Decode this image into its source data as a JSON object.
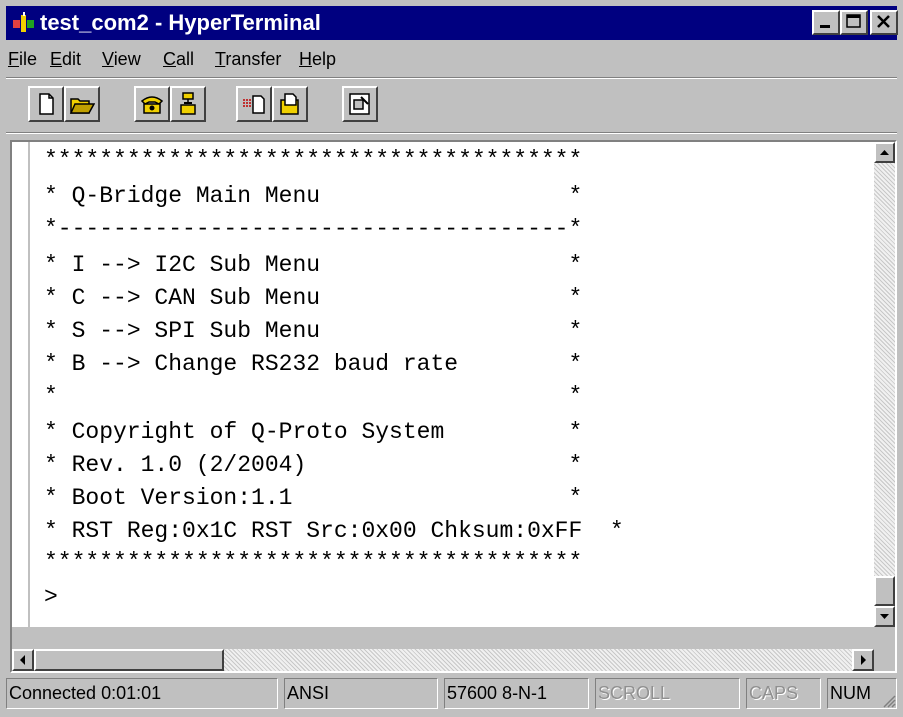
{
  "window": {
    "title": "test_com2 - HyperTerminal",
    "title_bar_color": "#000080",
    "app_icon": "hyperterminal-icon",
    "controls": [
      "minimize-icon",
      "maximize-icon",
      "close-icon"
    ]
  },
  "menu": {
    "items": [
      {
        "accel": "F",
        "rest": "ile"
      },
      {
        "accel": "E",
        "rest": "dit"
      },
      {
        "accel": "V",
        "rest": "iew"
      },
      {
        "accel": "C",
        "rest": "all"
      },
      {
        "accel": "T",
        "rest": "ransfer"
      },
      {
        "accel": "H",
        "rest": "elp"
      }
    ]
  },
  "toolbar": {
    "buttons": [
      "new-icon",
      "open-icon",
      "connect-icon",
      "disconnect-icon",
      "send-icon",
      "receive-icon",
      "properties-icon"
    ]
  },
  "terminal": {
    "lines": [
      "***************************************",
      "* Q-Bridge Main Menu                  *",
      "*-------------------------------------*",
      "* I --> I2C Sub Menu                  *",
      "* C --> CAN Sub Menu                  *",
      "* S --> SPI Sub Menu                  *",
      "* B --> Change RS232 baud rate        *",
      "*                                     *",
      "* Copyright of Q-Proto System         *",
      "* Rev. 1.0 (2/2004)                   *",
      "* Boot Version:1.1                    *",
      "* RST Reg:0x1C RST Src:0x00 Chksum:0xFF  *",
      "***************************************",
      ">"
    ]
  },
  "status": {
    "connection": "Connected 0:01:01",
    "emulation": "ANSI",
    "settings": "57600 8-N-1",
    "scroll": "SCROLL",
    "caps": "CAPS",
    "num": "NUM"
  }
}
